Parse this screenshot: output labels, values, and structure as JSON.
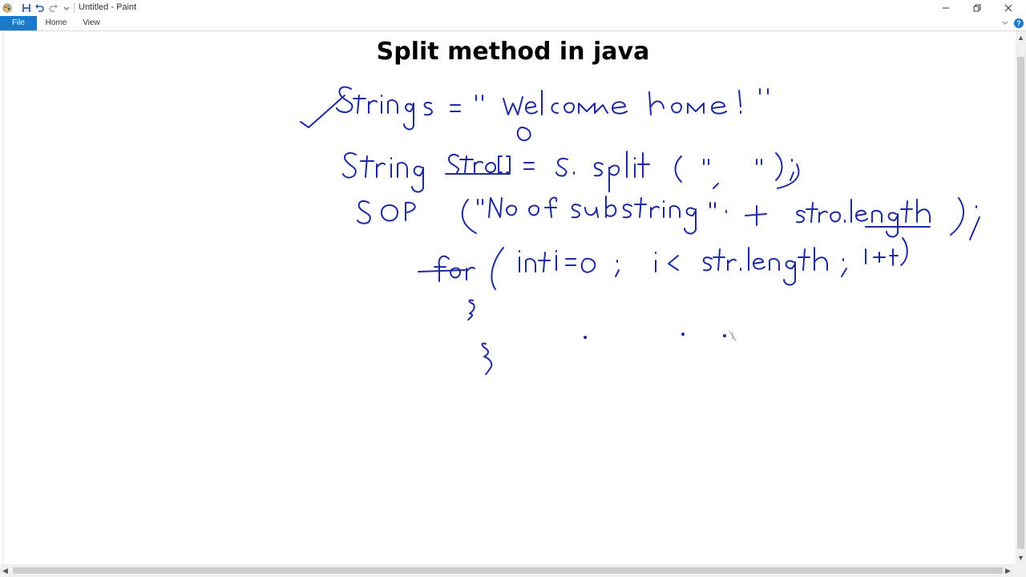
{
  "window": {
    "title": "Untitled - Paint"
  },
  "ribbon": {
    "tabs": [
      "File",
      "Home",
      "View"
    ],
    "help": "?"
  },
  "canvas": {
    "title": "Split method in java"
  },
  "colors": {
    "accent": "#1979ca",
    "ink": "#1f2a9e"
  }
}
